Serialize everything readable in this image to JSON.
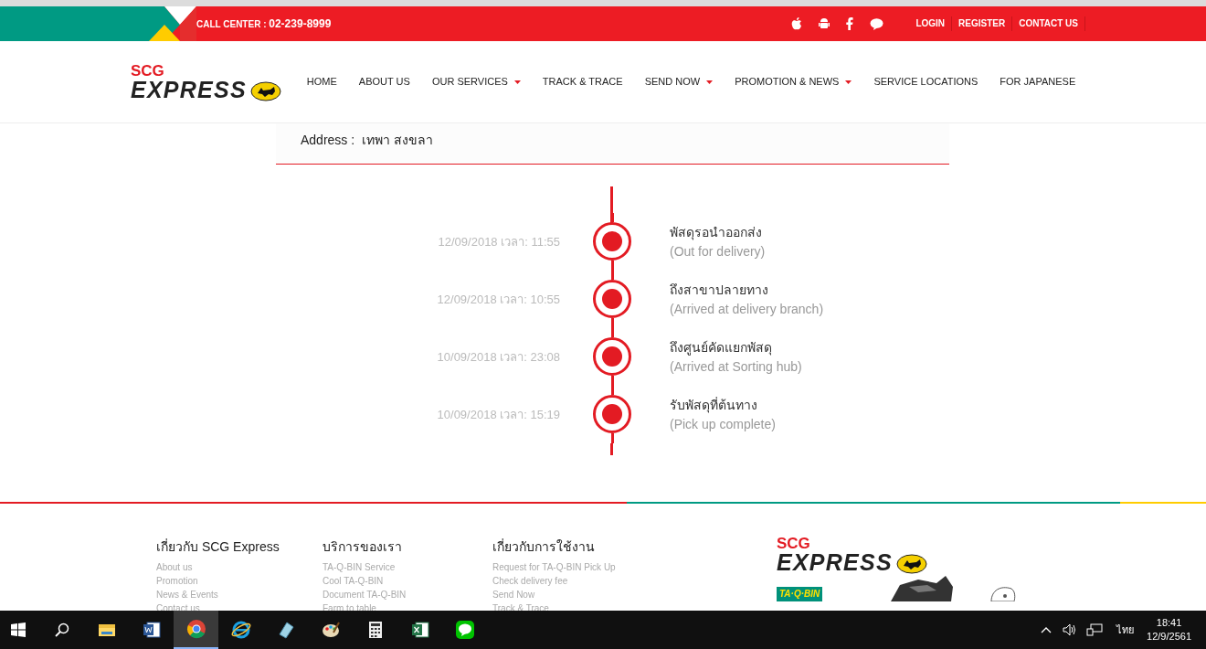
{
  "topbar": {
    "call_center_label": "CALL CENTER :",
    "call_center_number": "02-239-8999",
    "links": [
      "LOGIN",
      "REGISTER",
      "CONTACT US"
    ]
  },
  "nav": {
    "logo_top": "SCG",
    "logo_bottom": "EXPRESS",
    "items": [
      {
        "label": "HOME",
        "dropdown": false
      },
      {
        "label": "ABOUT US",
        "dropdown": false
      },
      {
        "label": "OUR SERVICES",
        "dropdown": true
      },
      {
        "label": "TRACK & TRACE",
        "dropdown": false
      },
      {
        "label": "SEND NOW",
        "dropdown": true
      },
      {
        "label": "PROMOTION & NEWS",
        "dropdown": true
      },
      {
        "label": "SERVICE LOCATIONS",
        "dropdown": false
      },
      {
        "label": "FOR JAPANESE",
        "dropdown": false
      }
    ]
  },
  "shipment": {
    "address_label": "Address :",
    "address_value": "เทพา สงขลา"
  },
  "timeline": [
    {
      "datetime": "12/09/2018 เวลา: 11:55",
      "status": "พัสดุรอนำออกส่ง",
      "status_en": "(Out for delivery)"
    },
    {
      "datetime": "12/09/2018 เวลา: 10:55",
      "status": "ถึงสาขาปลายทาง",
      "status_en": "(Arrived at delivery branch)"
    },
    {
      "datetime": "10/09/2018 เวลา: 23:08",
      "status": "ถึงศูนย์คัดแยกพัสดุ",
      "status_en": "(Arrived at Sorting hub)"
    },
    {
      "datetime": "10/09/2018 เวลา: 15:19",
      "status": "รับพัสดุที่ต้นทาง",
      "status_en": "(Pick up complete)"
    }
  ],
  "footer": {
    "columns": [
      {
        "title": "เกี่ยวกับ SCG Express",
        "links": [
          "About us",
          "Promotion",
          "News & Events",
          "Contact us"
        ]
      },
      {
        "title": "บริการของเรา",
        "links": [
          "TA-Q-BIN Service",
          "Cool TA-Q-BIN",
          "Document TA-Q-BIN",
          "Farm to table"
        ]
      },
      {
        "title": "เกี่ยวกับการใช้งาน",
        "links": [
          "Request for TA-Q-BIN Pick Up",
          "Check delivery fee",
          "Send Now",
          "Track & Trace"
        ]
      }
    ],
    "logo_top": "SCG",
    "logo_bottom": "EXPRESS",
    "badge": "TA·Q·BIN"
  },
  "taskbar": {
    "apps": [
      {
        "kind": "explorer",
        "selected": false
      },
      {
        "kind": "word",
        "selected": false
      },
      {
        "kind": "chrome",
        "selected": true
      },
      {
        "kind": "ie",
        "selected": false
      },
      {
        "kind": "notes",
        "selected": false
      },
      {
        "kind": "paint",
        "selected": false
      },
      {
        "kind": "calculator",
        "selected": false
      },
      {
        "kind": "excel",
        "selected": false
      },
      {
        "kind": "line",
        "selected": false
      }
    ],
    "language": "ไทย",
    "time": "18:41",
    "date": "12/9/2561"
  }
}
